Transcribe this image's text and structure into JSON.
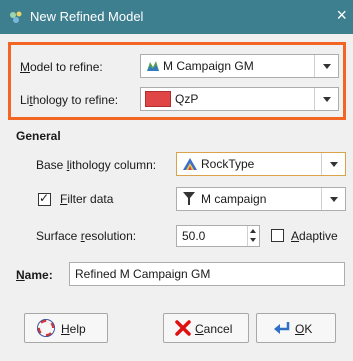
{
  "window": {
    "title": "New Refined Model",
    "close_glyph": "×"
  },
  "highlight": {
    "border_color": "#f26522"
  },
  "model_to_refine": {
    "label_pre": "",
    "label_key": "M",
    "label_post": "odel to refine:",
    "value": "M Campaign GM"
  },
  "lithology_to_refine": {
    "label_pre": "Li",
    "label_key": "t",
    "label_post": "hology to refine:",
    "value": "QzP",
    "swatch_color": "#e04646"
  },
  "general": {
    "title": "General",
    "base_lithology": {
      "label_pre": "Base ",
      "label_key": "l",
      "label_post": "ithology column:",
      "value": "RockType"
    },
    "filter_data": {
      "checked": true,
      "check_glyph": "✓",
      "label_key": "F",
      "label_post": "ilter data",
      "value": "M campaign"
    },
    "surface_resolution": {
      "label_pre": "Surface ",
      "label_key": "r",
      "label_post": "esolution:",
      "value": "50.0"
    },
    "adaptive": {
      "checked": false,
      "label_key": "A",
      "label_post": "daptive"
    }
  },
  "name": {
    "label_key": "N",
    "label_post": "ame:",
    "value": "Refined M Campaign GM"
  },
  "buttons": {
    "help": {
      "label_key": "H",
      "label_post": "elp"
    },
    "cancel": {
      "label_key": "C",
      "label_post": "ancel"
    },
    "ok": {
      "label_key": "O",
      "label_post": "K"
    }
  }
}
